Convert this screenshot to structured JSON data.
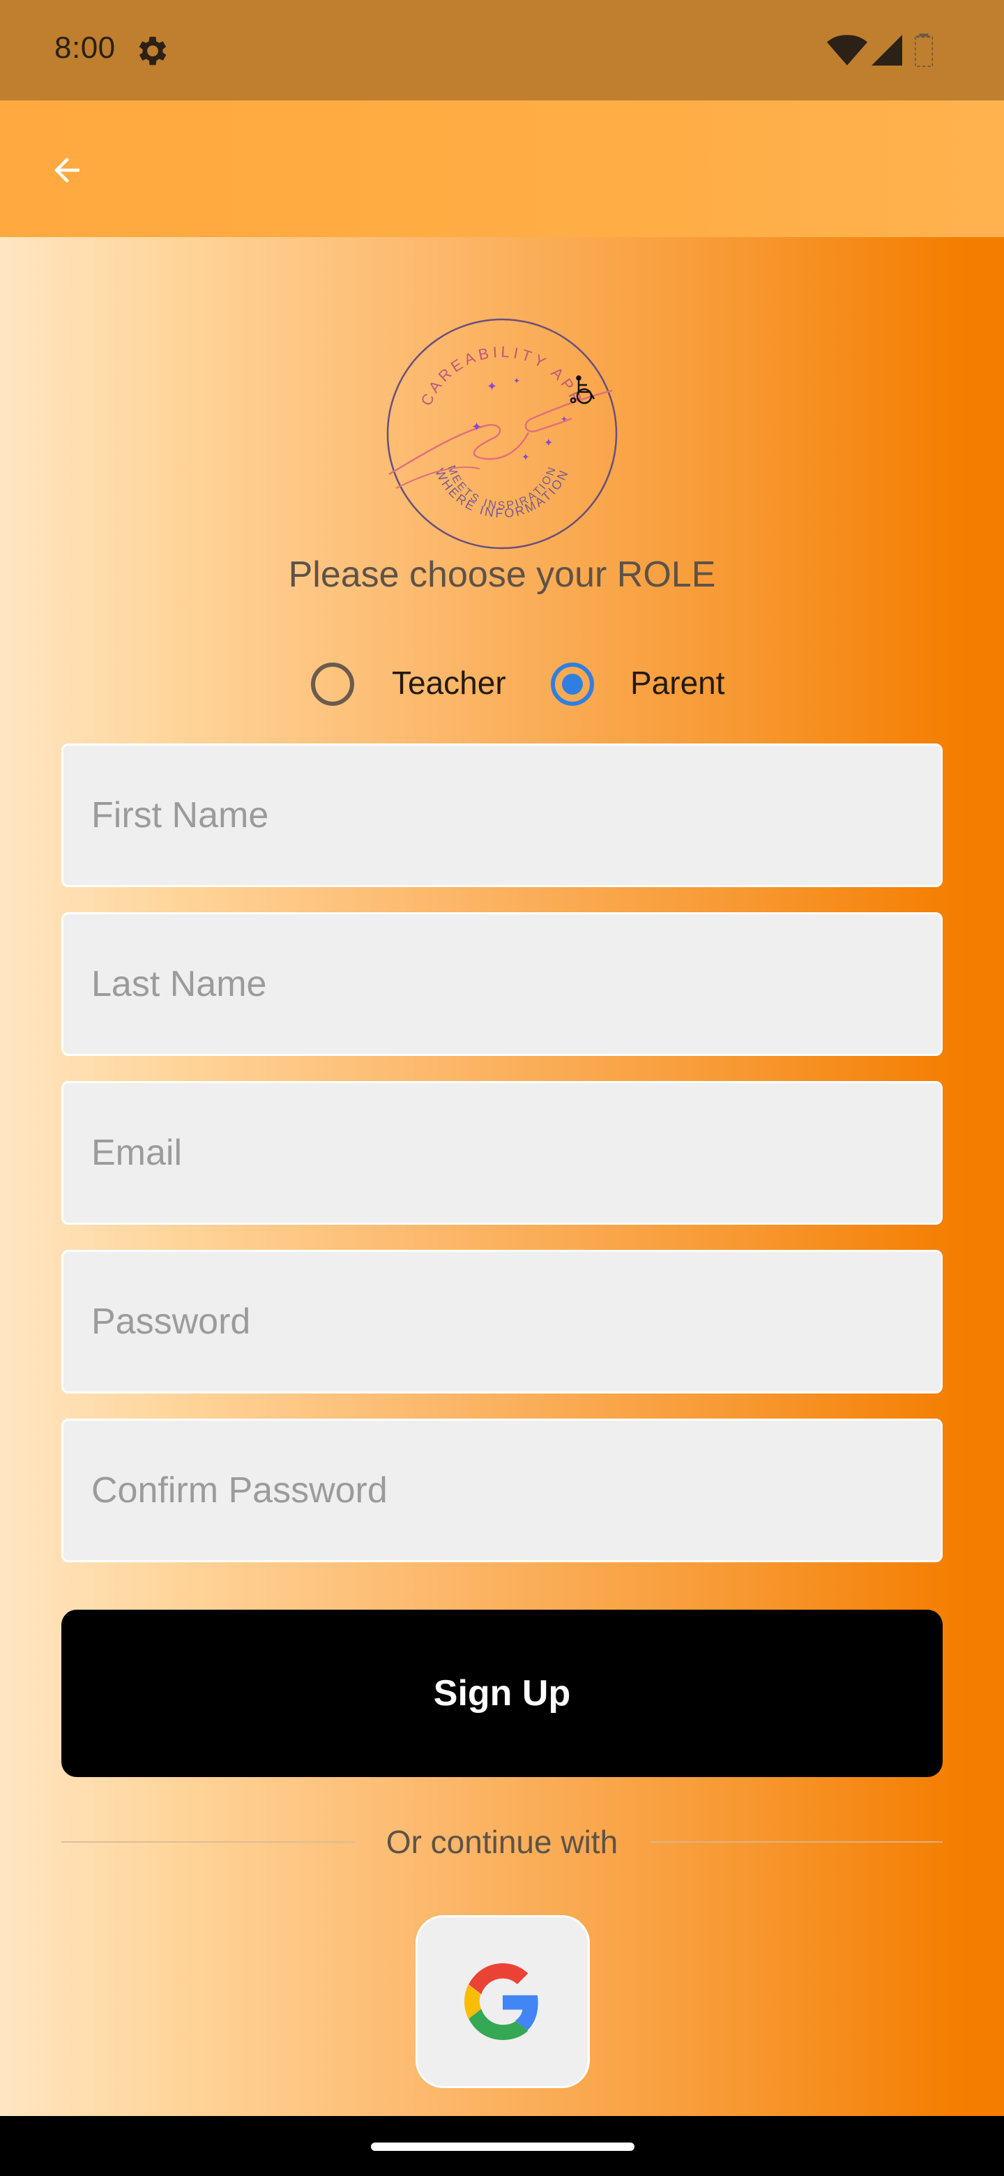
{
  "status_bar": {
    "time": "8:00",
    "icons": [
      "gear-icon",
      "wifi-icon",
      "cellular-signal-icon",
      "battery-icon"
    ]
  },
  "app_bar": {
    "back_icon": "arrow-left-icon"
  },
  "logo": {
    "top_text": "CAREABILITY APP",
    "bottom_text_line1": "WHERE INFORMATION",
    "bottom_text_line2": "MEETS INSPIRATION"
  },
  "role": {
    "title": "Please choose your ROLE",
    "options": [
      {
        "label": "Teacher",
        "selected": false
      },
      {
        "label": "Parent",
        "selected": true
      }
    ]
  },
  "form": {
    "first_name_placeholder": "First Name",
    "last_name_placeholder": "Last Name",
    "email_placeholder": "Email",
    "password_placeholder": "Password",
    "confirm_password_placeholder": "Confirm Password",
    "first_name_value": "",
    "last_name_value": "",
    "email_value": "",
    "password_value": "",
    "confirm_password_value": ""
  },
  "signup_button_label": "Sign Up",
  "divider_text": "Or continue with",
  "social": {
    "google_icon": "google-icon"
  },
  "colors": {
    "status_bar": "#bf7f2e",
    "app_bar": "#ffad45",
    "accent_radio": "#2f7fe0",
    "button": "#000000",
    "gradient_left": "#ffe6c2",
    "gradient_right": "#f47d00"
  }
}
